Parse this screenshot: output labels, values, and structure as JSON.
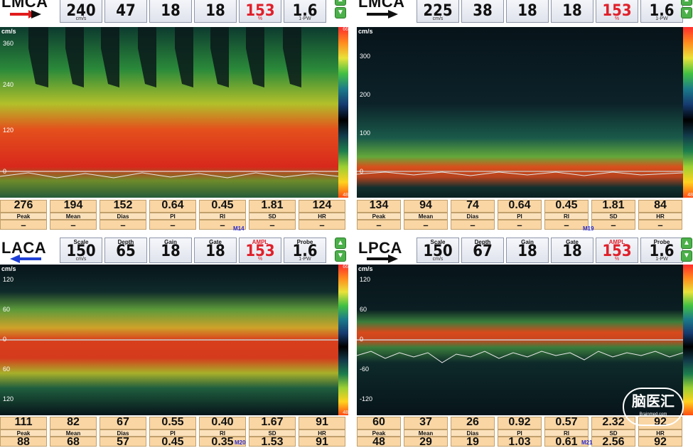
{
  "panels": [
    {
      "vessel": "LMCA",
      "arrow": "red-right",
      "params": [
        {
          "label": "",
          "value": "240",
          "unit": "cm/s"
        },
        {
          "label": "",
          "value": "47",
          "unit": ""
        },
        {
          "label": "",
          "value": "18",
          "unit": ""
        },
        {
          "label": "",
          "value": "18",
          "unit": ""
        },
        {
          "label": "",
          "value": "153",
          "unit": "%"
        },
        {
          "label": "",
          "value": "1.6",
          "unit": "1-PW"
        }
      ],
      "axis_unit": "cm/s",
      "ticks": [
        "360",
        "240",
        "120",
        "0"
      ],
      "colorbar_top": "66",
      "colorbar_bottom": "48",
      "result_values": [
        "276",
        "194",
        "152",
        "0.64",
        "0.45",
        "1.81",
        "124"
      ],
      "result_labels": [
        "Peak",
        "Mean",
        "Dias",
        "PI",
        "RI",
        "SD",
        "HR"
      ],
      "result_second": [
        "–",
        "–",
        "–",
        "–",
        "–",
        "–",
        "–"
      ],
      "marker": "M14"
    },
    {
      "vessel": "LMCA",
      "arrow": "black-right",
      "params": [
        {
          "label": "",
          "value": "225",
          "unit": "cm/s"
        },
        {
          "label": "",
          "value": "38",
          "unit": ""
        },
        {
          "label": "",
          "value": "18",
          "unit": ""
        },
        {
          "label": "",
          "value": "18",
          "unit": ""
        },
        {
          "label": "",
          "value": "153",
          "unit": "%"
        },
        {
          "label": "",
          "value": "1.6",
          "unit": "1-PW"
        }
      ],
      "axis_unit": "cm/s",
      "ticks": [
        "300",
        "200",
        "100",
        "0"
      ],
      "colorbar_top": "",
      "colorbar_bottom": "48",
      "result_values": [
        "134",
        "94",
        "74",
        "0.64",
        "0.45",
        "1.81",
        "84"
      ],
      "result_labels": [
        "Peak",
        "Mean",
        "Dias",
        "PI",
        "RI",
        "SD",
        "HR"
      ],
      "result_second": [
        "–",
        "–",
        "–",
        "–",
        "–",
        "–",
        "–"
      ],
      "marker": "M19"
    },
    {
      "vessel": "LACA",
      "arrow": "blue-left",
      "params": [
        {
          "label": "Scale",
          "value": "150",
          "unit": "cm/s"
        },
        {
          "label": "Depth",
          "value": "65",
          "unit": ""
        },
        {
          "label": "Gain",
          "value": "18",
          "unit": ""
        },
        {
          "label": "Gate",
          "value": "18",
          "unit": ""
        },
        {
          "label": "AMPL",
          "value": "153",
          "unit": "%"
        },
        {
          "label": "Probe",
          "value": "1.6",
          "unit": "1-PW"
        }
      ],
      "axis_unit": "cm/s",
      "ticks": [
        "120",
        "60",
        "0",
        "60",
        "120"
      ],
      "colorbar_top": "66",
      "colorbar_bottom": "48",
      "result_values": [
        "111",
        "82",
        "67",
        "0.55",
        "0.40",
        "1.67",
        "91"
      ],
      "result_labels": [
        "Peak",
        "Mean",
        "Dias",
        "PI",
        "RI",
        "SD",
        "HR"
      ],
      "result_second": [
        "88",
        "68",
        "57",
        "0.45",
        "0.35",
        "1.53",
        "91"
      ],
      "marker": "M20"
    },
    {
      "vessel": "LPCA",
      "arrow": "black-right",
      "params": [
        {
          "label": "Scale",
          "value": "150",
          "unit": "cm/s"
        },
        {
          "label": "Depth",
          "value": "67",
          "unit": ""
        },
        {
          "label": "Gain",
          "value": "18",
          "unit": ""
        },
        {
          "label": "Gate",
          "value": "18",
          "unit": ""
        },
        {
          "label": "AMPL",
          "value": "153",
          "unit": "%"
        },
        {
          "label": "Probe",
          "value": "1.6",
          "unit": "1-PW"
        }
      ],
      "axis_unit": "cm/s",
      "ticks": [
        "120",
        "60",
        "0",
        "-60",
        "-120"
      ],
      "colorbar_top": "",
      "colorbar_bottom": "",
      "result_values": [
        "60",
        "37",
        "26",
        "0.92",
        "0.57",
        "2.32",
        "92"
      ],
      "result_labels": [
        "Peak",
        "Mean",
        "Dias",
        "PI",
        "RI",
        "SD",
        "HR"
      ],
      "result_second": [
        "48",
        "29",
        "19",
        "1.03",
        "0.61",
        "2.56",
        "92"
      ],
      "marker": "M21"
    }
  ],
  "watermark": {
    "line1": "脑医汇",
    "line2": "Brainmed.com"
  },
  "colors": {
    "result_bg": "#f9d6a4",
    "ampl": "#e0202a",
    "spectrum_bg": "#0b1518"
  }
}
